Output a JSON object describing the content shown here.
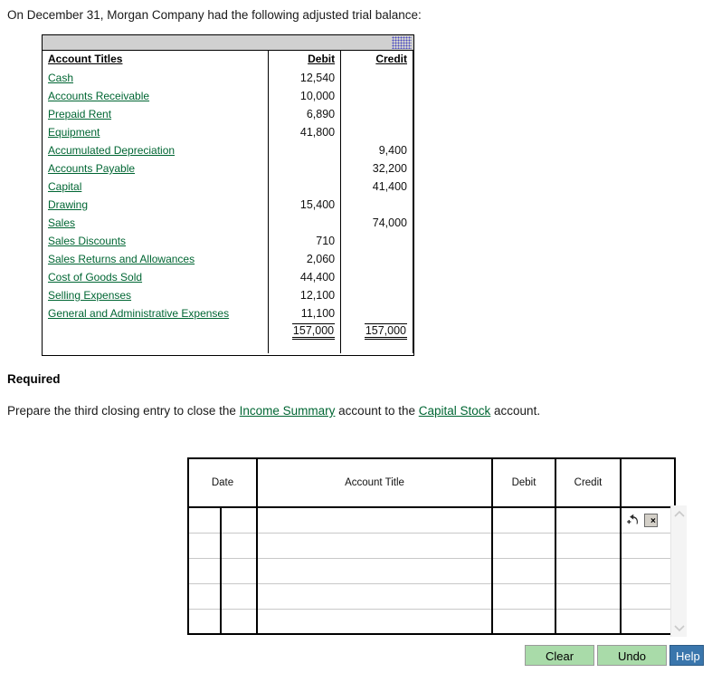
{
  "intro": "On December 31, Morgan Company had the following adjusted trial balance:",
  "trial_balance": {
    "headers": [
      "Account Titles",
      "Debit",
      "Credit"
    ],
    "rows": [
      {
        "account": "Cash",
        "debit": "12,540",
        "credit": ""
      },
      {
        "account": "Accounts Receivable",
        "debit": "10,000",
        "credit": ""
      },
      {
        "account": "Prepaid Rent",
        "debit": "6,890",
        "credit": ""
      },
      {
        "account": "Equipment",
        "debit": "41,800",
        "credit": ""
      },
      {
        "account": "Accumulated Depreciation",
        "debit": "",
        "credit": "9,400"
      },
      {
        "account": "Accounts Payable",
        "debit": "",
        "credit": "32,200"
      },
      {
        "account": "Capital",
        "debit": "",
        "credit": "41,400"
      },
      {
        "account": "Drawing",
        "debit": "15,400",
        "credit": ""
      },
      {
        "account": "Sales",
        "debit": "",
        "credit": "74,000"
      },
      {
        "account": "Sales Discounts",
        "debit": "710",
        "credit": ""
      },
      {
        "account": "Sales Returns and Allowances",
        "debit": "2,060",
        "credit": ""
      },
      {
        "account": "Cost of Goods Sold",
        "debit": "44,400",
        "credit": ""
      },
      {
        "account": "Selling Expenses",
        "debit": "12,100",
        "credit": ""
      },
      {
        "account": "General and Administrative Expenses",
        "debit": "11,100",
        "credit": ""
      }
    ],
    "totals": {
      "debit": "157,000",
      "credit": "157,000"
    }
  },
  "required": {
    "heading": "Required",
    "text_part1": "Prepare the third closing entry to close the ",
    "link1": "Income Summary",
    "text_part2": " account to the ",
    "link2": "Capital Stock",
    "text_part3": " account."
  },
  "journal": {
    "headers": {
      "date": "Date",
      "account_title": "Account Title",
      "debit": "Debit",
      "credit": "Credit",
      "tools": ""
    },
    "rows": [
      {
        "date1": "",
        "date2": "",
        "account": "",
        "debit": "",
        "credit": "",
        "has_tools": true
      },
      {
        "date1": "",
        "date2": "",
        "account": "",
        "debit": "",
        "credit": "",
        "has_tools": false
      },
      {
        "date1": "",
        "date2": "",
        "account": "",
        "debit": "",
        "credit": "",
        "has_tools": false
      },
      {
        "date1": "",
        "date2": "",
        "account": "",
        "debit": "",
        "credit": "",
        "has_tools": false
      },
      {
        "date1": "",
        "date2": "",
        "account": "",
        "debit": "",
        "credit": "",
        "has_tools": false
      }
    ],
    "row_tools": {
      "undo_row_icon": "undo-row-icon",
      "delete_row_label": "×"
    },
    "scrollbar": {
      "up_icon": "chevron-up-icon",
      "down_icon": "chevron-down-icon"
    }
  },
  "buttons": {
    "clear": "Clear",
    "undo": "Undo",
    "help": "Help"
  },
  "colors": {
    "link_green": "#006633",
    "button_green": "#a9dba9",
    "help_blue": "#3a76ac",
    "titlebar_gray": "#d0d0d0"
  }
}
